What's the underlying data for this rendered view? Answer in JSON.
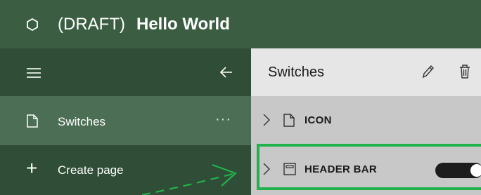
{
  "app": {
    "draft_label": "(DRAFT)",
    "app_name": "Hello World"
  },
  "nav": {
    "active_item": {
      "label": "Switches",
      "more": "···"
    },
    "create": {
      "label": "Create page"
    }
  },
  "pane": {
    "title": "Switches",
    "rows": [
      {
        "label": "ICON"
      },
      {
        "label": "HEADER BAR",
        "toggle_on": true
      }
    ]
  },
  "colors": {
    "topbar": "#3b5e43",
    "nav": "#2f4d37",
    "nav_active": "#4c6e55",
    "highlight": "#21b24b"
  }
}
